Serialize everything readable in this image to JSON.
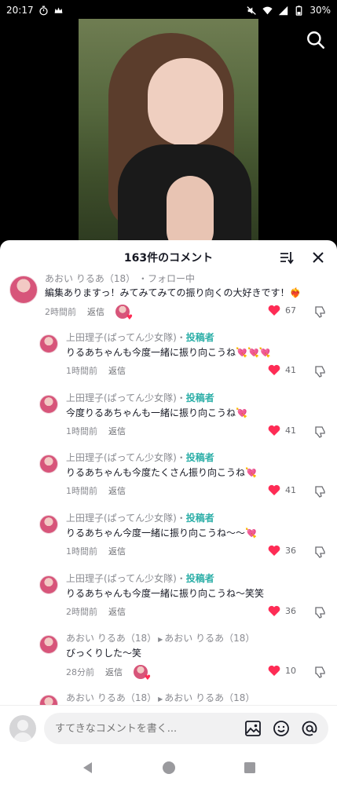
{
  "status_bar": {
    "time": "20:17",
    "battery": "30%"
  },
  "sheet": {
    "title": "163件のコメント"
  },
  "comments": [
    {
      "author": "あおい りるあ（18）",
      "follow": "フォロー中",
      "text": "編集ありますっ！みてみてみての振り向くの大好きです！❤️‍🔥",
      "time": "2時間前",
      "reply": "返信",
      "likes": "67"
    },
    {
      "author": "上田理子(ぱってん少女隊)",
      "tag": "投稿者",
      "text": "りるあちゃんも今度一緒に振り向こうね💘💘💘",
      "time": "1時間前",
      "reply": "返信",
      "likes": "41"
    },
    {
      "author": "上田理子(ぱってん少女隊)",
      "tag": "投稿者",
      "text": "今度りるあちゃんも一緒に振り向こうね💘",
      "time": "1時間前",
      "reply": "返信",
      "likes": "41"
    },
    {
      "author": "上田理子(ぱってん少女隊)",
      "tag": "投稿者",
      "text": "りるあちゃんも今度たくさん振り向こうね💘",
      "time": "1時間前",
      "reply": "返信",
      "likes": "41"
    },
    {
      "author": "上田理子(ぱってん少女隊)",
      "tag": "投稿者",
      "text": "りるあちゃん今度一緒に振り向こうね〜〜💘",
      "time": "1時間前",
      "reply": "返信",
      "likes": "36"
    },
    {
      "author": "上田理子(ぱってん少女隊)",
      "tag": "投稿者",
      "text": "りるあちゃんも今度一緒に振り向こうね〜笑笑",
      "time": "2時間前",
      "reply": "返信",
      "likes": "36"
    },
    {
      "author": "あおい りるあ（18）",
      "reply_to": "あおい りるあ（18）",
      "text": "びっくりした〜笑",
      "time": "28分前",
      "reply": "返信",
      "likes": "10"
    },
    {
      "author": "あおい りるあ（18）",
      "reply_to": "あおい りるあ（18）"
    }
  ],
  "input": {
    "placeholder": "すてきなコメントを書く..."
  },
  "icons": {
    "search": "search-icon",
    "sort": "sort-icon",
    "close": "close-icon",
    "heart": "heart-icon",
    "dislike": "thumbs-down-icon",
    "image": "image-icon",
    "emoji": "emoji-icon",
    "mention": "at-mention-icon",
    "back": "back-triangle-icon",
    "home": "home-circle-icon",
    "recents": "recents-square-icon"
  },
  "colors": {
    "heart": "#fe2c55",
    "creator_tag": "#2dafa8"
  }
}
